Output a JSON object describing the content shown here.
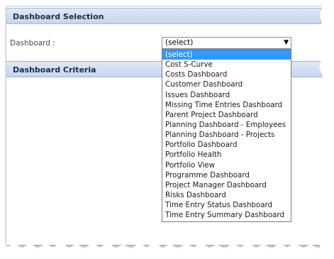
{
  "section1": {
    "title": "Dashboard Selection"
  },
  "section2": {
    "title": "Dashboard Criteria"
  },
  "form": {
    "label": "Dashboard :",
    "select_value": "(select)"
  },
  "dropdown": {
    "options": [
      "(select)",
      "Cost S-Curve",
      "Costs Dashboard",
      "Customer Dashboard",
      "Issues Dashboard",
      "Missing Time Entries Dashboard",
      "Parent Project Dashboard",
      "Planning Dashboard - Employees",
      "Planning Dashboard - Projects",
      "Portfolio Dashboard",
      "Portfolio Health",
      "Portfolio View",
      "Programme Dashboard",
      "Project Manager Dashboard",
      "Risks Dashboard",
      "Time Entry Status Dashboard",
      "Time Entry Summary Dashboard"
    ],
    "selected_index": 0
  },
  "colors": {
    "header_bg": "#c6d5f2",
    "selected_bg": "#3399ff"
  },
  "icons": {
    "dropdown_arrow": "triangle-down-icon"
  }
}
